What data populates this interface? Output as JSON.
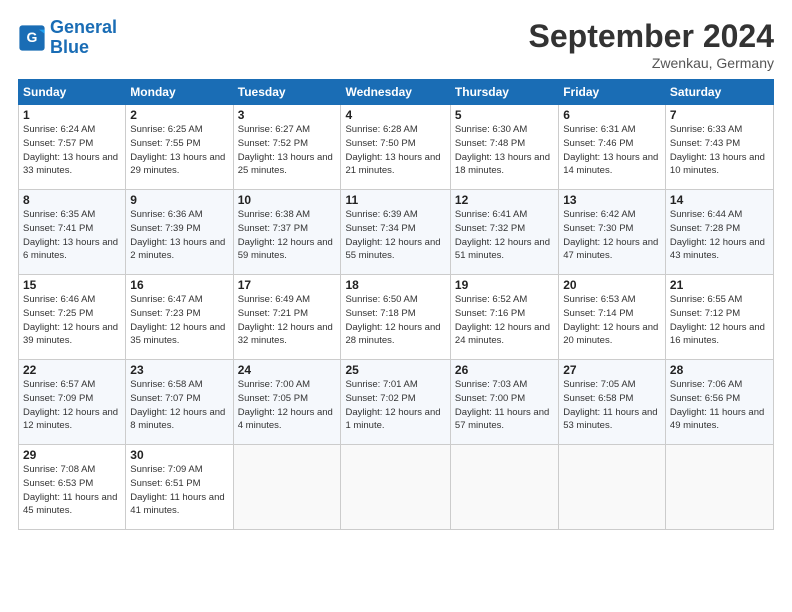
{
  "header": {
    "logo_line1": "General",
    "logo_line2": "Blue",
    "month_title": "September 2024",
    "subtitle": "Zwenkau, Germany"
  },
  "weekdays": [
    "Sunday",
    "Monday",
    "Tuesday",
    "Wednesday",
    "Thursday",
    "Friday",
    "Saturday"
  ],
  "weeks": [
    [
      {
        "day": "1",
        "sunrise": "Sunrise: 6:24 AM",
        "sunset": "Sunset: 7:57 PM",
        "daylight": "Daylight: 13 hours and 33 minutes."
      },
      {
        "day": "2",
        "sunrise": "Sunrise: 6:25 AM",
        "sunset": "Sunset: 7:55 PM",
        "daylight": "Daylight: 13 hours and 29 minutes."
      },
      {
        "day": "3",
        "sunrise": "Sunrise: 6:27 AM",
        "sunset": "Sunset: 7:52 PM",
        "daylight": "Daylight: 13 hours and 25 minutes."
      },
      {
        "day": "4",
        "sunrise": "Sunrise: 6:28 AM",
        "sunset": "Sunset: 7:50 PM",
        "daylight": "Daylight: 13 hours and 21 minutes."
      },
      {
        "day": "5",
        "sunrise": "Sunrise: 6:30 AM",
        "sunset": "Sunset: 7:48 PM",
        "daylight": "Daylight: 13 hours and 18 minutes."
      },
      {
        "day": "6",
        "sunrise": "Sunrise: 6:31 AM",
        "sunset": "Sunset: 7:46 PM",
        "daylight": "Daylight: 13 hours and 14 minutes."
      },
      {
        "day": "7",
        "sunrise": "Sunrise: 6:33 AM",
        "sunset": "Sunset: 7:43 PM",
        "daylight": "Daylight: 13 hours and 10 minutes."
      }
    ],
    [
      {
        "day": "8",
        "sunrise": "Sunrise: 6:35 AM",
        "sunset": "Sunset: 7:41 PM",
        "daylight": "Daylight: 13 hours and 6 minutes."
      },
      {
        "day": "9",
        "sunrise": "Sunrise: 6:36 AM",
        "sunset": "Sunset: 7:39 PM",
        "daylight": "Daylight: 13 hours and 2 minutes."
      },
      {
        "day": "10",
        "sunrise": "Sunrise: 6:38 AM",
        "sunset": "Sunset: 7:37 PM",
        "daylight": "Daylight: 12 hours and 59 minutes."
      },
      {
        "day": "11",
        "sunrise": "Sunrise: 6:39 AM",
        "sunset": "Sunset: 7:34 PM",
        "daylight": "Daylight: 12 hours and 55 minutes."
      },
      {
        "day": "12",
        "sunrise": "Sunrise: 6:41 AM",
        "sunset": "Sunset: 7:32 PM",
        "daylight": "Daylight: 12 hours and 51 minutes."
      },
      {
        "day": "13",
        "sunrise": "Sunrise: 6:42 AM",
        "sunset": "Sunset: 7:30 PM",
        "daylight": "Daylight: 12 hours and 47 minutes."
      },
      {
        "day": "14",
        "sunrise": "Sunrise: 6:44 AM",
        "sunset": "Sunset: 7:28 PM",
        "daylight": "Daylight: 12 hours and 43 minutes."
      }
    ],
    [
      {
        "day": "15",
        "sunrise": "Sunrise: 6:46 AM",
        "sunset": "Sunset: 7:25 PM",
        "daylight": "Daylight: 12 hours and 39 minutes."
      },
      {
        "day": "16",
        "sunrise": "Sunrise: 6:47 AM",
        "sunset": "Sunset: 7:23 PM",
        "daylight": "Daylight: 12 hours and 35 minutes."
      },
      {
        "day": "17",
        "sunrise": "Sunrise: 6:49 AM",
        "sunset": "Sunset: 7:21 PM",
        "daylight": "Daylight: 12 hours and 32 minutes."
      },
      {
        "day": "18",
        "sunrise": "Sunrise: 6:50 AM",
        "sunset": "Sunset: 7:18 PM",
        "daylight": "Daylight: 12 hours and 28 minutes."
      },
      {
        "day": "19",
        "sunrise": "Sunrise: 6:52 AM",
        "sunset": "Sunset: 7:16 PM",
        "daylight": "Daylight: 12 hours and 24 minutes."
      },
      {
        "day": "20",
        "sunrise": "Sunrise: 6:53 AM",
        "sunset": "Sunset: 7:14 PM",
        "daylight": "Daylight: 12 hours and 20 minutes."
      },
      {
        "day": "21",
        "sunrise": "Sunrise: 6:55 AM",
        "sunset": "Sunset: 7:12 PM",
        "daylight": "Daylight: 12 hours and 16 minutes."
      }
    ],
    [
      {
        "day": "22",
        "sunrise": "Sunrise: 6:57 AM",
        "sunset": "Sunset: 7:09 PM",
        "daylight": "Daylight: 12 hours and 12 minutes."
      },
      {
        "day": "23",
        "sunrise": "Sunrise: 6:58 AM",
        "sunset": "Sunset: 7:07 PM",
        "daylight": "Daylight: 12 hours and 8 minutes."
      },
      {
        "day": "24",
        "sunrise": "Sunrise: 7:00 AM",
        "sunset": "Sunset: 7:05 PM",
        "daylight": "Daylight: 12 hours and 4 minutes."
      },
      {
        "day": "25",
        "sunrise": "Sunrise: 7:01 AM",
        "sunset": "Sunset: 7:02 PM",
        "daylight": "Daylight: 12 hours and 1 minute."
      },
      {
        "day": "26",
        "sunrise": "Sunrise: 7:03 AM",
        "sunset": "Sunset: 7:00 PM",
        "daylight": "Daylight: 11 hours and 57 minutes."
      },
      {
        "day": "27",
        "sunrise": "Sunrise: 7:05 AM",
        "sunset": "Sunset: 6:58 PM",
        "daylight": "Daylight: 11 hours and 53 minutes."
      },
      {
        "day": "28",
        "sunrise": "Sunrise: 7:06 AM",
        "sunset": "Sunset: 6:56 PM",
        "daylight": "Daylight: 11 hours and 49 minutes."
      }
    ],
    [
      {
        "day": "29",
        "sunrise": "Sunrise: 7:08 AM",
        "sunset": "Sunset: 6:53 PM",
        "daylight": "Daylight: 11 hours and 45 minutes."
      },
      {
        "day": "30",
        "sunrise": "Sunrise: 7:09 AM",
        "sunset": "Sunset: 6:51 PM",
        "daylight": "Daylight: 11 hours and 41 minutes."
      },
      null,
      null,
      null,
      null,
      null
    ]
  ]
}
